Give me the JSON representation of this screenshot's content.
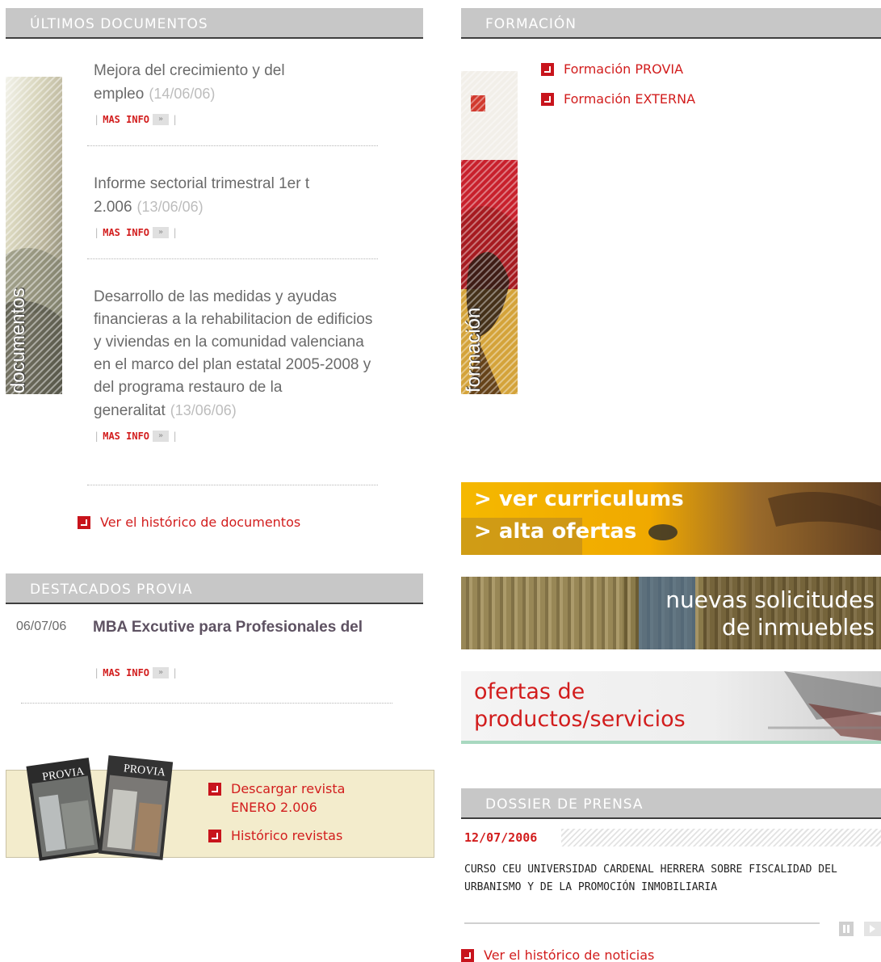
{
  "documents": {
    "header": "ÚLTIMOS DOCUMENTOS",
    "side_label": "documentos",
    "items": [
      {
        "title": "Mejora del crecimiento y del empleo",
        "date": "(14/06/06)",
        "more": "MAS INFO"
      },
      {
        "title": "Informe sectorial trimestral 1er t 2.006",
        "date": "(13/06/06)",
        "more": "MAS INFO"
      },
      {
        "title": "Desarrollo de las medidas y ayudas financieras a la rehabilitacion de edificios y viviendas en la comunidad valenciana en el marco del plan estatal 2005-2008 y del programa restauro de la generalitat",
        "date": "(13/06/06)",
        "more": "MAS INFO"
      }
    ],
    "history_link": "Ver el histórico de documentos"
  },
  "formacion": {
    "header": "FORMACIÓN",
    "side_label": "formación",
    "links": [
      "Formación PROVIA",
      "Formación EXTERNA"
    ]
  },
  "destacados": {
    "header": "DESTACADOS PROVIA",
    "items": [
      {
        "date": "06/07/06",
        "title": "MBA Excutive para Profesionales del",
        "more": "MAS INFO"
      }
    ]
  },
  "revista": {
    "cover_text": "PROVIA",
    "download_link": "Descargar revista ENERO 2.006",
    "history_link": "Histórico revistas"
  },
  "banners": {
    "curriculums": {
      "line1": "> ver curriculums",
      "line2": "> alta ofertas"
    },
    "inmuebles": {
      "line1": "nuevas solicitudes",
      "line2": "de inmuebles"
    },
    "ofertas": {
      "line1": "ofertas de",
      "line2": "productos/servicios"
    }
  },
  "prensa": {
    "header": "DOSSIER DE PRENSA",
    "date": "12/07/2006",
    "text": "CURSO CEU UNIVERSIDAD CARDENAL HERRERA SOBRE FISCALIDAD DEL URBANISMO Y DE LA PROMOCIÓN INMOBILIARIA",
    "history_link": "Ver el histórico de noticias"
  },
  "colors": {
    "accent_red": "#d21d1d",
    "header_gray": "#c7c7c7",
    "header_border": "#3e3e3e",
    "magazine_bg": "#f3eccc"
  },
  "icons": {
    "link_bullet": "red-square-arrow-icon",
    "more_arrow": "double-chevron-right-icon",
    "pause": "pause-icon",
    "next": "play-next-icon"
  }
}
